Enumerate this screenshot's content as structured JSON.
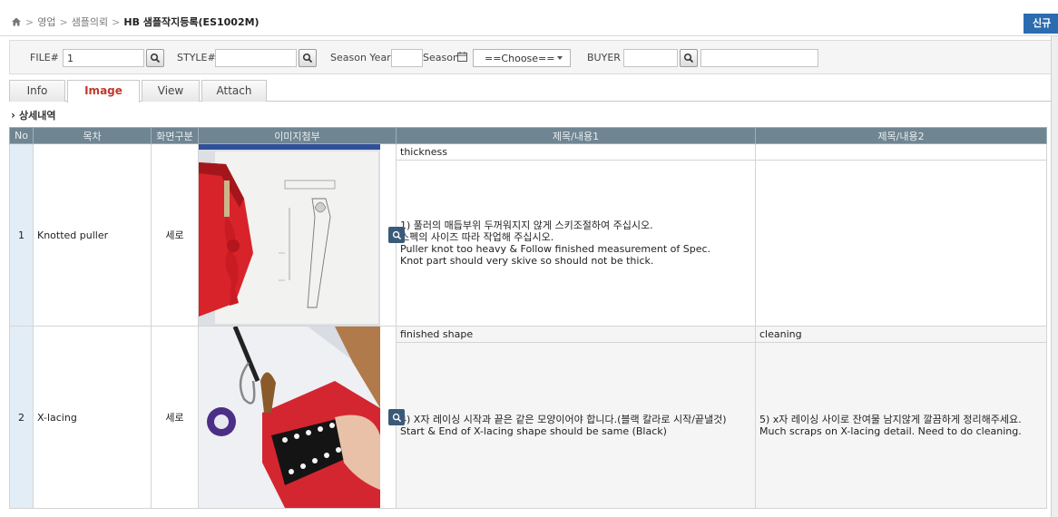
{
  "breadcrumb": {
    "items": [
      "영업",
      "샘플의뢰"
    ],
    "current": "HB 샘플작지등록(ES1002M)",
    "new_button": "신규"
  },
  "search": {
    "file_label": "FILE#",
    "file_value": "1",
    "style_label": "STYLE#",
    "style_value": "",
    "season_year_label": "Season Year",
    "season_year_value": "",
    "season_label": "Season",
    "season_selected": "==Choose==",
    "buyer_label": "BUYER",
    "buyer_code_value": "",
    "buyer_name_value": ""
  },
  "tabs": [
    {
      "label": "Info",
      "active": false
    },
    {
      "label": "Image",
      "active": true
    },
    {
      "label": "View",
      "active": false
    },
    {
      "label": "Attach",
      "active": false
    }
  ],
  "section": {
    "title": "상세내역"
  },
  "grid": {
    "headers": [
      "No",
      "목차",
      "화면구분",
      "이미지첨부",
      "제목/내용1",
      "제목/내용2"
    ],
    "rows": [
      {
        "no": "1",
        "item": "Knotted puller",
        "screen_type": "세로",
        "title1": "thickness",
        "body1": [
          "1) 풀러의 매듭부위 두꺼워지지 않게 스키조절하여 주십시오.",
          "스펙의 사이즈 따라 작업해 주십시오.",
          "Puller knot too heavy & Follow finished measurement of Spec.",
          "Knot part should very skive so should not be thick."
        ],
        "title2": "",
        "body2": []
      },
      {
        "no": "2",
        "item": "X-lacing",
        "screen_type": "세로",
        "title1": "finished shape",
        "body1": [
          "4) X자 레이싱 시작과 끝은 같은 모양이어야 합니다.(블랙 칼라로 시작/끝낼것)",
          "Start & End of X-lacing shape should be same (Black)"
        ],
        "title2": "cleaning",
        "body2": [
          "5) x자 레이싱 사이로 잔여물 남지않게 깔끔하게 정리해주세요.",
          "Much scraps on X-lacing detail. Need to do cleaning."
        ]
      }
    ]
  },
  "colors": {
    "header_bg": "#6f8591",
    "active_tab_text": "#c0392b",
    "new_button_bg": "#2b6cb0",
    "no_cell_bg": "#e3edf6"
  },
  "icons": [
    "home-icon",
    "search-icon",
    "calendar-icon",
    "chevron-right-icon",
    "zoom-icon"
  ]
}
